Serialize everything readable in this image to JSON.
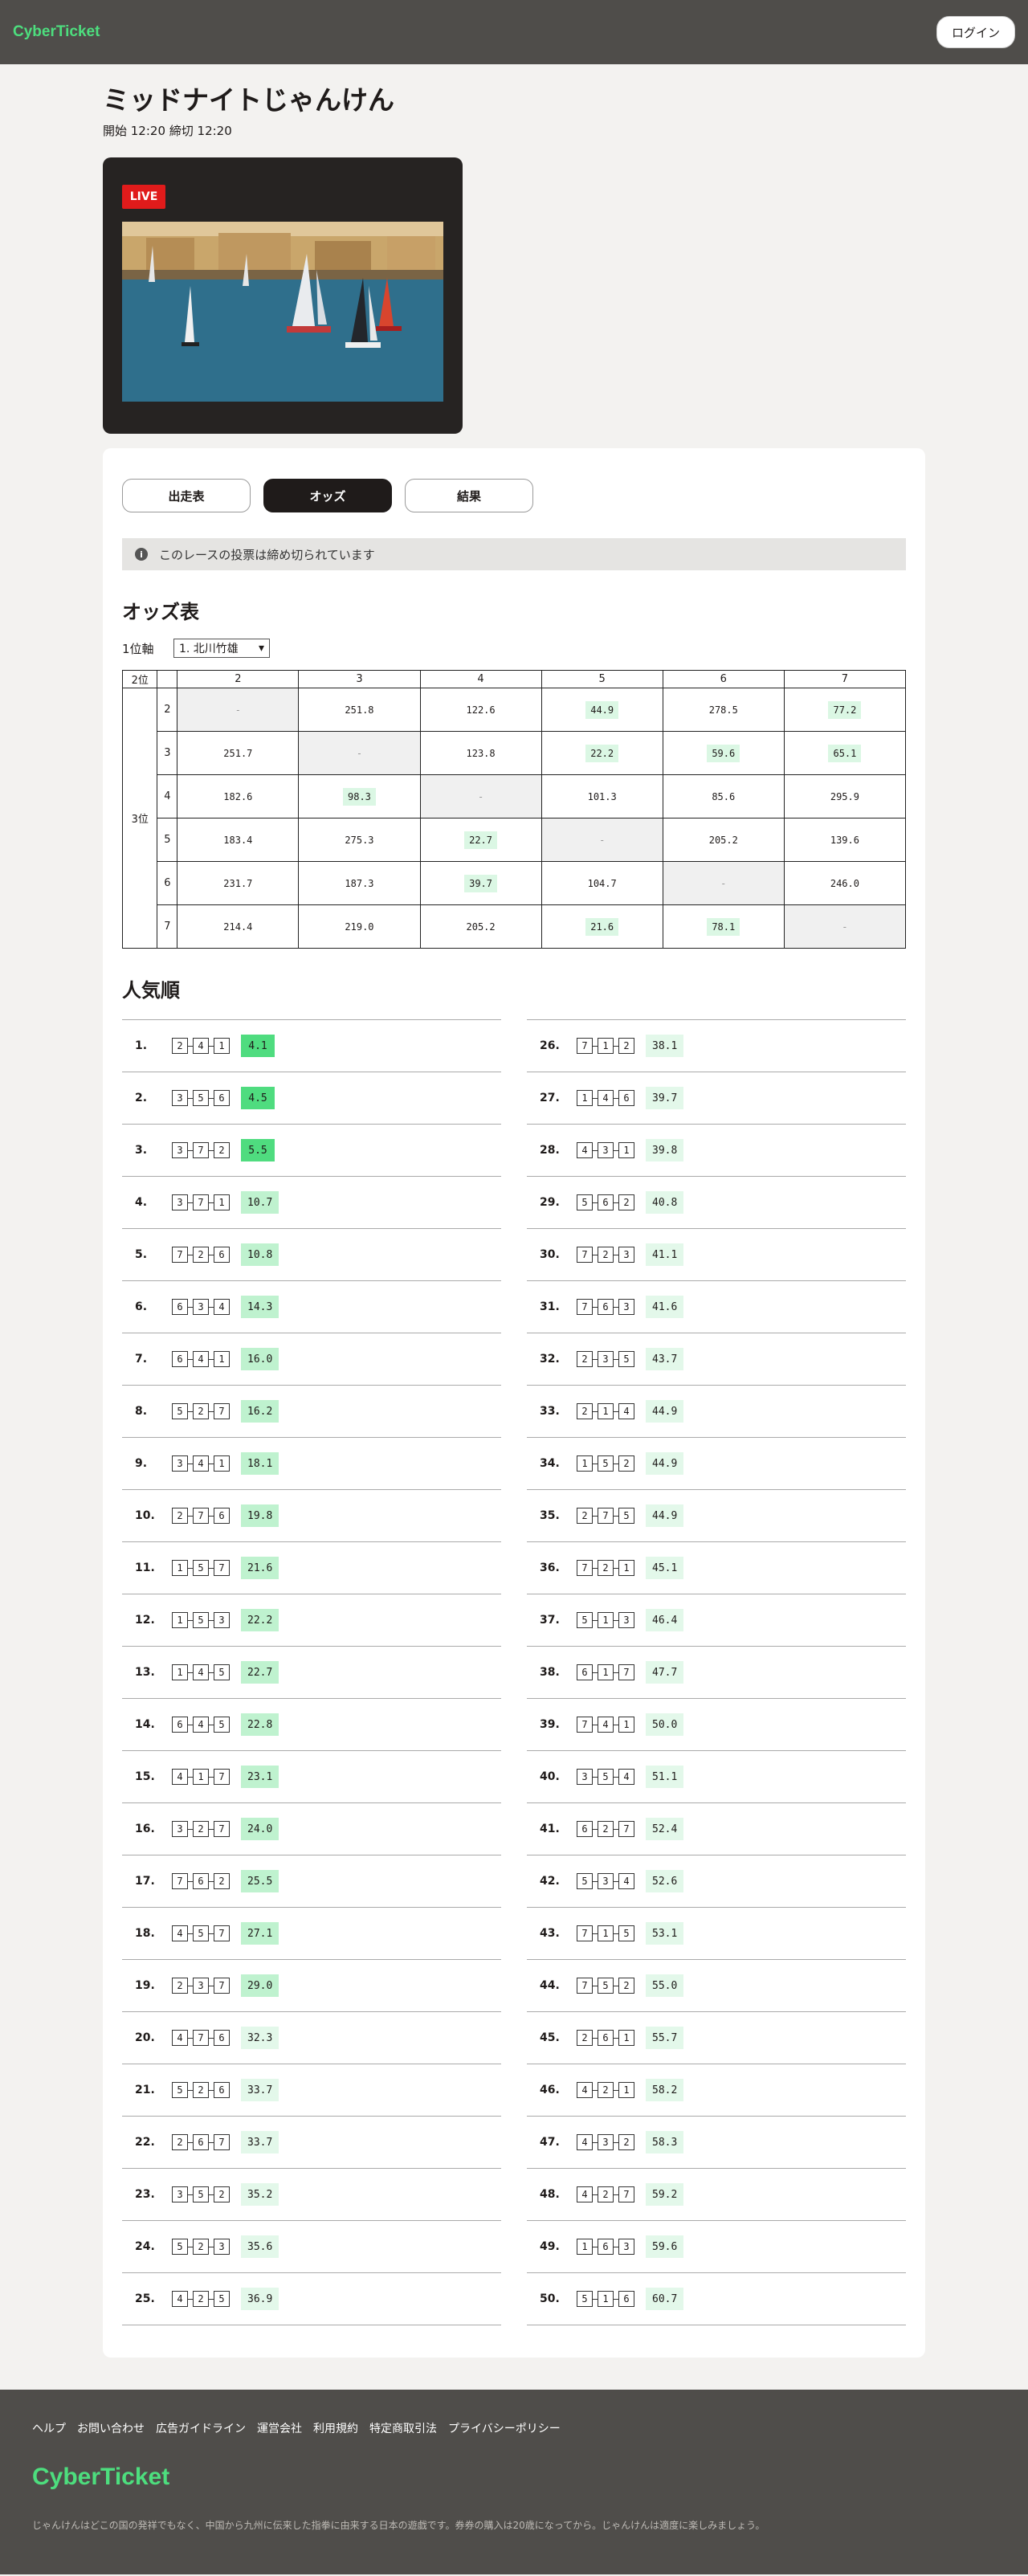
{
  "header": {
    "logo": "CyberTicket",
    "login_label": "ログイン"
  },
  "race": {
    "title": "ミッドナイトじゃんけん",
    "meta": "開始 12:20 締切 12:20",
    "live_label": "LIVE"
  },
  "tabs": [
    {
      "label": "出走表"
    },
    {
      "label": "オッズ"
    },
    {
      "label": "結果"
    }
  ],
  "notice": {
    "icon": "i",
    "text": "このレースの投票は締め切られています"
  },
  "odds": {
    "title": "オッズ表",
    "axis_label": "1位軸",
    "axis_value": "1. 北川竹雄",
    "corner_label": "2位",
    "side_label": "3位",
    "columns": [
      "2",
      "3",
      "4",
      "5",
      "6",
      "7"
    ],
    "rows": [
      {
        "label": "2",
        "cells": [
          "-",
          "251.8",
          "122.6",
          "44.9",
          "278.5",
          "77.2"
        ],
        "hl": [
          0,
          0,
          0,
          1,
          0,
          1
        ]
      },
      {
        "label": "3",
        "cells": [
          "251.7",
          "-",
          "123.8",
          "22.2",
          "59.6",
          "65.1"
        ],
        "hl": [
          0,
          0,
          0,
          1,
          1,
          1
        ]
      },
      {
        "label": "4",
        "cells": [
          "182.6",
          "98.3",
          "-",
          "101.3",
          "85.6",
          "295.9"
        ],
        "hl": [
          0,
          1,
          0,
          0,
          0,
          0
        ]
      },
      {
        "label": "5",
        "cells": [
          "183.4",
          "275.3",
          "22.7",
          "-",
          "205.2",
          "139.6"
        ],
        "hl": [
          0,
          0,
          1,
          0,
          0,
          0
        ]
      },
      {
        "label": "6",
        "cells": [
          "231.7",
          "187.3",
          "39.7",
          "104.7",
          "-",
          "246.0"
        ],
        "hl": [
          0,
          0,
          1,
          0,
          0,
          0
        ]
      },
      {
        "label": "7",
        "cells": [
          "214.4",
          "219.0",
          "205.2",
          "21.6",
          "78.1",
          "-"
        ],
        "hl": [
          0,
          0,
          0,
          1,
          1,
          0
        ]
      }
    ]
  },
  "popular": {
    "title": "人気順",
    "items": [
      {
        "rank": "1.",
        "c": [
          "2",
          "4",
          "1"
        ],
        "odds": "4.1"
      },
      {
        "rank": "2.",
        "c": [
          "3",
          "5",
          "6"
        ],
        "odds": "4.5"
      },
      {
        "rank": "3.",
        "c": [
          "3",
          "7",
          "2"
        ],
        "odds": "5.5"
      },
      {
        "rank": "4.",
        "c": [
          "3",
          "7",
          "1"
        ],
        "odds": "10.7"
      },
      {
        "rank": "5.",
        "c": [
          "7",
          "2",
          "6"
        ],
        "odds": "10.8"
      },
      {
        "rank": "6.",
        "c": [
          "6",
          "3",
          "4"
        ],
        "odds": "14.3"
      },
      {
        "rank": "7.",
        "c": [
          "6",
          "4",
          "1"
        ],
        "odds": "16.0"
      },
      {
        "rank": "8.",
        "c": [
          "5",
          "2",
          "7"
        ],
        "odds": "16.2"
      },
      {
        "rank": "9.",
        "c": [
          "3",
          "4",
          "1"
        ],
        "odds": "18.1"
      },
      {
        "rank": "10.",
        "c": [
          "2",
          "7",
          "6"
        ],
        "odds": "19.8"
      },
      {
        "rank": "11.",
        "c": [
          "1",
          "5",
          "7"
        ],
        "odds": "21.6"
      },
      {
        "rank": "12.",
        "c": [
          "1",
          "5",
          "3"
        ],
        "odds": "22.2"
      },
      {
        "rank": "13.",
        "c": [
          "1",
          "4",
          "5"
        ],
        "odds": "22.7"
      },
      {
        "rank": "14.",
        "c": [
          "6",
          "4",
          "5"
        ],
        "odds": "22.8"
      },
      {
        "rank": "15.",
        "c": [
          "4",
          "1",
          "7"
        ],
        "odds": "23.1"
      },
      {
        "rank": "16.",
        "c": [
          "3",
          "2",
          "7"
        ],
        "odds": "24.0"
      },
      {
        "rank": "17.",
        "c": [
          "7",
          "6",
          "2"
        ],
        "odds": "25.5"
      },
      {
        "rank": "18.",
        "c": [
          "4",
          "5",
          "7"
        ],
        "odds": "27.1"
      },
      {
        "rank": "19.",
        "c": [
          "2",
          "3",
          "7"
        ],
        "odds": "29.0"
      },
      {
        "rank": "20.",
        "c": [
          "4",
          "7",
          "6"
        ],
        "odds": "32.3"
      },
      {
        "rank": "21.",
        "c": [
          "5",
          "2",
          "6"
        ],
        "odds": "33.7"
      },
      {
        "rank": "22.",
        "c": [
          "2",
          "6",
          "7"
        ],
        "odds": "33.7"
      },
      {
        "rank": "23.",
        "c": [
          "3",
          "5",
          "2"
        ],
        "odds": "35.2"
      },
      {
        "rank": "24.",
        "c": [
          "5",
          "2",
          "3"
        ],
        "odds": "35.6"
      },
      {
        "rank": "25.",
        "c": [
          "4",
          "2",
          "5"
        ],
        "odds": "36.9"
      },
      {
        "rank": "26.",
        "c": [
          "7",
          "1",
          "2"
        ],
        "odds": "38.1"
      },
      {
        "rank": "27.",
        "c": [
          "1",
          "4",
          "6"
        ],
        "odds": "39.7"
      },
      {
        "rank": "28.",
        "c": [
          "4",
          "3",
          "1"
        ],
        "odds": "39.8"
      },
      {
        "rank": "29.",
        "c": [
          "5",
          "6",
          "2"
        ],
        "odds": "40.8"
      },
      {
        "rank": "30.",
        "c": [
          "7",
          "2",
          "3"
        ],
        "odds": "41.1"
      },
      {
        "rank": "31.",
        "c": [
          "7",
          "6",
          "3"
        ],
        "odds": "41.6"
      },
      {
        "rank": "32.",
        "c": [
          "2",
          "3",
          "5"
        ],
        "odds": "43.7"
      },
      {
        "rank": "33.",
        "c": [
          "2",
          "1",
          "4"
        ],
        "odds": "44.9"
      },
      {
        "rank": "34.",
        "c": [
          "1",
          "5",
          "2"
        ],
        "odds": "44.9"
      },
      {
        "rank": "35.",
        "c": [
          "2",
          "7",
          "5"
        ],
        "odds": "44.9"
      },
      {
        "rank": "36.",
        "c": [
          "7",
          "2",
          "1"
        ],
        "odds": "45.1"
      },
      {
        "rank": "37.",
        "c": [
          "5",
          "1",
          "3"
        ],
        "odds": "46.4"
      },
      {
        "rank": "38.",
        "c": [
          "6",
          "1",
          "7"
        ],
        "odds": "47.7"
      },
      {
        "rank": "39.",
        "c": [
          "7",
          "4",
          "1"
        ],
        "odds": "50.0"
      },
      {
        "rank": "40.",
        "c": [
          "3",
          "5",
          "4"
        ],
        "odds": "51.1"
      },
      {
        "rank": "41.",
        "c": [
          "6",
          "2",
          "7"
        ],
        "odds": "52.4"
      },
      {
        "rank": "42.",
        "c": [
          "5",
          "3",
          "4"
        ],
        "odds": "52.6"
      },
      {
        "rank": "43.",
        "c": [
          "7",
          "1",
          "5"
        ],
        "odds": "53.1"
      },
      {
        "rank": "44.",
        "c": [
          "7",
          "5",
          "2"
        ],
        "odds": "55.0"
      },
      {
        "rank": "45.",
        "c": [
          "2",
          "6",
          "1"
        ],
        "odds": "55.7"
      },
      {
        "rank": "46.",
        "c": [
          "4",
          "2",
          "1"
        ],
        "odds": "58.2"
      },
      {
        "rank": "47.",
        "c": [
          "4",
          "3",
          "2"
        ],
        "odds": "58.3"
      },
      {
        "rank": "48.",
        "c": [
          "4",
          "2",
          "7"
        ],
        "odds": "59.2"
      },
      {
        "rank": "49.",
        "c": [
          "1",
          "6",
          "3"
        ],
        "odds": "59.6"
      },
      {
        "rank": "50.",
        "c": [
          "5",
          "1",
          "6"
        ],
        "odds": "60.7"
      }
    ]
  },
  "footer": {
    "links": [
      "ヘルプ",
      "お問い合わせ",
      "広告ガイドライン",
      "運営会社",
      "利用規約",
      "特定商取引法",
      "プライバシーポリシー"
    ],
    "logo": "CyberTicket",
    "text": "じゃんけんはどこの国の発祥でもなく、中国から九州に伝来した指拳に由来する日本の遊戯です。券券の購入は20歳になってから。じゃんけんは適度に楽しみましょう。"
  },
  "colors": {
    "brand": "#4dde7e",
    "header_bg": "#4f4d4a",
    "live": "#e01b1b",
    "odds_strong": "#4fdc7f",
    "odds_mid": "#bff2cf",
    "odds_light": "#e3f8ea"
  }
}
